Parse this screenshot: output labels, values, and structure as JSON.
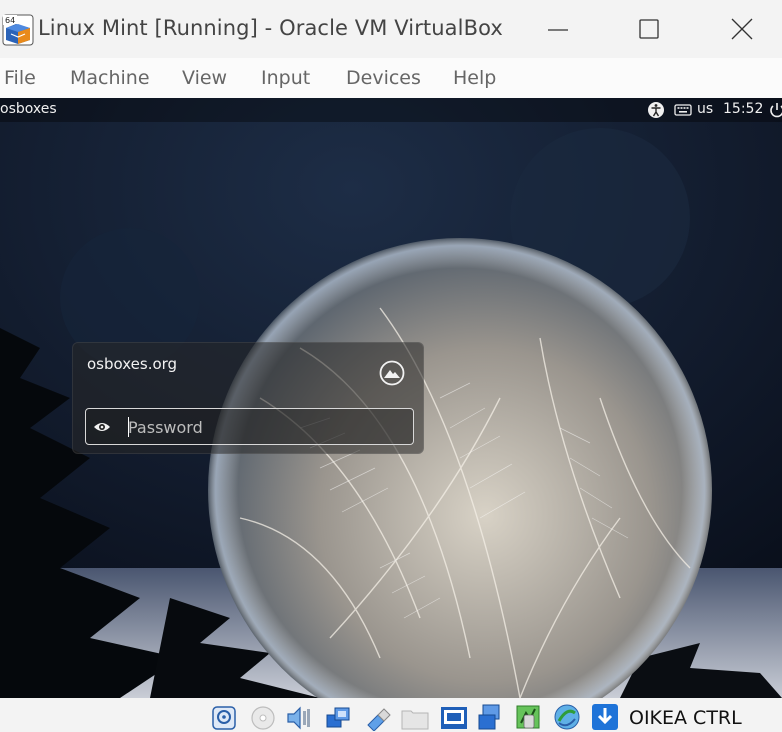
{
  "window": {
    "title": "Linux Mint [Running] - Oracle VM VirtualBox",
    "app_icon_badge": "64"
  },
  "menubar": {
    "items": [
      {
        "label": "File"
      },
      {
        "label": "Machine"
      },
      {
        "label": "View"
      },
      {
        "label": "Input"
      },
      {
        "label": "Devices"
      },
      {
        "label": "Help"
      }
    ]
  },
  "vm": {
    "topbar": {
      "hostname": "osboxes",
      "keyboard_layout": "us",
      "time": "15:52",
      "icons": [
        "accessibility-icon",
        "keyboard-icon",
        "power-icon"
      ]
    },
    "login": {
      "host": "osboxes.org",
      "password_placeholder": "Password",
      "icons": [
        "mint-logo-icon",
        "show-password-icon"
      ]
    }
  },
  "statusbar": {
    "host_key": "OIKEA CTRL",
    "icons": [
      "hard-disk-icon",
      "optical-drive-icon",
      "audio-icon",
      "network-icon",
      "usb-icon",
      "shared-folders-icon",
      "display-icon",
      "recording-icon",
      "mouse-integration-icon",
      "cpu-icon",
      "arrow-down-icon"
    ]
  },
  "colors": {
    "titlebar": "#f3f3f3",
    "vm_background": "#0c1423",
    "accent_blue": "#1e73d8"
  }
}
